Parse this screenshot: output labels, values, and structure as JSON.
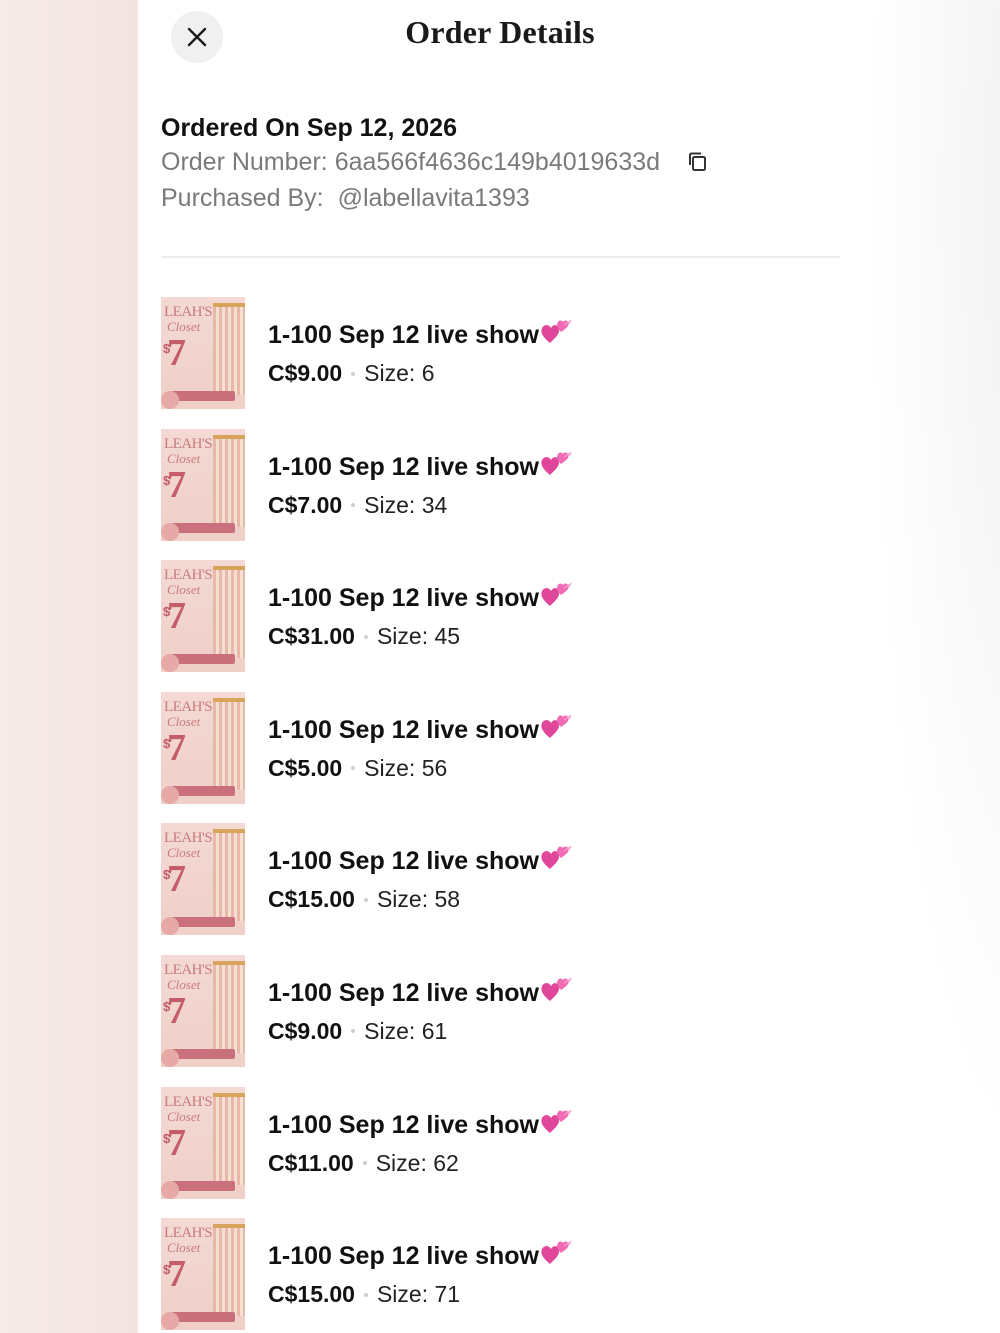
{
  "header": {
    "title": "Order Details",
    "close_icon": "close-icon"
  },
  "order": {
    "ordered_on": "Ordered On Sep 12, 2026",
    "order_number_label": "Order Number:",
    "order_number": "6aa566f4636c149b4019633d",
    "purchased_by_label": "Purchased By:",
    "purchased_by": "@labellavita1393",
    "copy_icon": "copy-icon"
  },
  "thumbnail": {
    "brand": "LEAH'S",
    "script": "Closet",
    "seven": "7",
    "dollar": "$"
  },
  "items": [
    {
      "title": "1-100 Sep 12 live show",
      "price": "C$9.00",
      "size": "Size: 6"
    },
    {
      "title": "1-100 Sep 12 live show",
      "price": "C$7.00",
      "size": "Size: 34"
    },
    {
      "title": "1-100 Sep 12 live show",
      "price": "C$31.00",
      "size": "Size: 45"
    },
    {
      "title": "1-100 Sep 12 live show",
      "price": "C$5.00",
      "size": "Size: 56"
    },
    {
      "title": "1-100 Sep 12 live show",
      "price": "C$15.00",
      "size": "Size: 58"
    },
    {
      "title": "1-100 Sep 12 live show",
      "price": "C$9.00",
      "size": "Size: 61"
    },
    {
      "title": "1-100 Sep 12 live show",
      "price": "C$11.00",
      "size": "Size: 62"
    },
    {
      "title": "1-100 Sep 12 live show",
      "price": "C$15.00",
      "size": "Size: 71"
    }
  ],
  "colors": {
    "heart": "#e0479b",
    "muted_text": "#7a7a7a",
    "close_bg": "#f0f0f0"
  }
}
